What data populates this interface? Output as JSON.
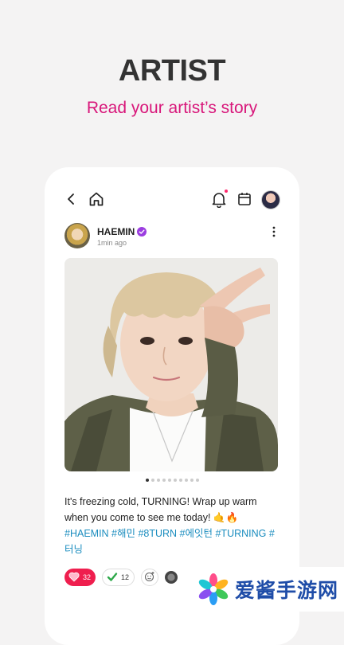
{
  "promo": {
    "headline": "ARTIST",
    "subheadline": "Read your artist’s story"
  },
  "header": {
    "icons": [
      "back-icon",
      "home-icon",
      "bell-icon",
      "calendar-icon",
      "profile-avatar"
    ]
  },
  "post": {
    "author": "HAEMIN",
    "time": "1min ago",
    "text": "It's freezing cold, TURNING! Wrap up warm when you come to see me today! 🤙🔥",
    "hashtags": "#HAEMIN #해민 #8TURN #에잇턴 #TURNING #터닝",
    "carousel": {
      "count": 10,
      "active": 1
    },
    "reactions": [
      {
        "icon": "heart-icon",
        "count": "32"
      },
      {
        "icon": "check-icon",
        "count": "12"
      }
    ]
  },
  "watermark": {
    "text": "爱酱手游网"
  },
  "colors": {
    "accent": "#d8167a",
    "hashtag": "#1b8dbf",
    "like": "#ef1e4e",
    "verified": "#9b3de0"
  }
}
